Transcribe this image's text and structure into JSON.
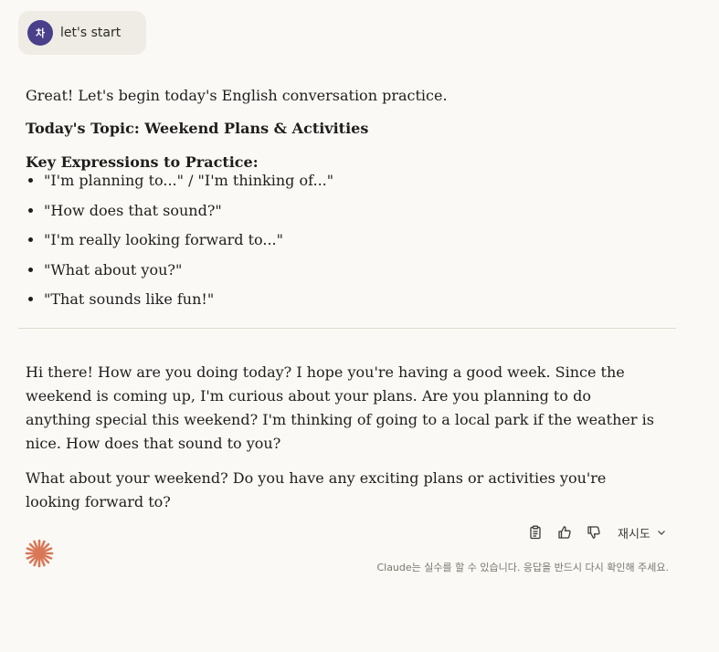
{
  "user_message": {
    "avatar_initial": "차",
    "text": "let's start"
  },
  "response": {
    "intro": "Great! Let's begin today's English conversation practice.",
    "topic": "Today's Topic: Weekend Plans & Activities",
    "key_heading": "Key Expressions to Practice:",
    "expressions": [
      "\"I'm planning to...\" / \"I'm thinking of...\"",
      "\"How does that sound?\"",
      "\"I'm really looking forward to...\"",
      "\"What about you?\"",
      "\"That sounds like fun!\""
    ],
    "paragraph1": "Hi there! How are you doing today? I hope you're having a good week. Since the weekend is coming up, I'm curious about your plans. Are you planning to do anything special this weekend? I'm thinking of going to a local park if the weather is nice. How does that sound to you?",
    "paragraph2": "What about your weekend? Do you have any exciting plans or activities you're looking forward to?"
  },
  "actions": {
    "copy_icon": "clipboard-icon",
    "thumbs_up_icon": "thumbs-up-icon",
    "thumbs_down_icon": "thumbs-down-icon",
    "retry_label": "재시도"
  },
  "footer": {
    "disclaimer": "Claude는 실수를 할 수 있습니다. 응답을 반드시 다시 확인해 주세요."
  },
  "colors": {
    "background": "#faf9f5",
    "bubble": "#eeece4",
    "avatar": "#4a3f8a",
    "logo": "#d97757"
  }
}
